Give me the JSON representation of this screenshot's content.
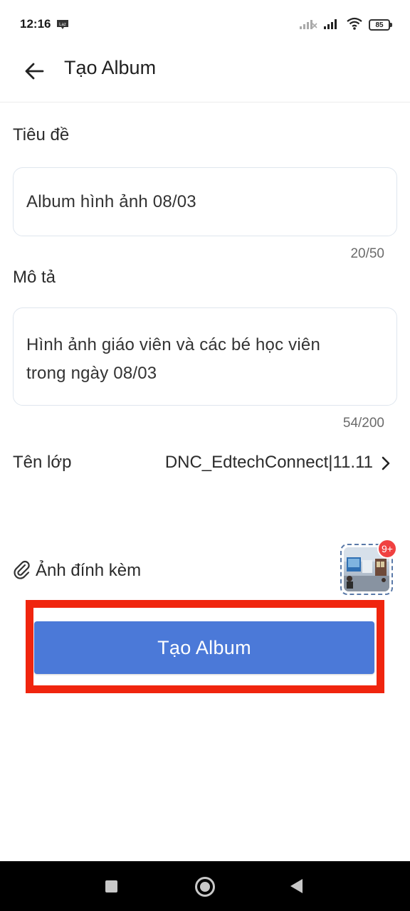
{
  "status_bar": {
    "time": "12:16",
    "laz_icon": "laz-icon",
    "battery": "85",
    "icons": [
      "no-signal-icon",
      "signal-icon",
      "wifi-icon",
      "battery-icon"
    ]
  },
  "header": {
    "back_icon": "arrow-left-icon",
    "title": "Tạo Album"
  },
  "form": {
    "title_label": "Tiêu đề",
    "title_value": "Album hình ảnh 08/03",
    "title_counter": "20/50",
    "description_label": "Mô tả",
    "description_value": "Hình ảnh giáo viên và các bé học viên trong ngày 08/03",
    "description_line1": "Hình ảnh giáo viên và các bé học viên",
    "description_line2": "trong ngày 08/03",
    "description_counter": "54/200",
    "class_label": "Tên lớp",
    "class_value": "DNC_EdtechConnect|11.11",
    "attachment_label": "Ảnh đính kèm",
    "attachment_icon": "paperclip-icon",
    "attachment_badge": "9+"
  },
  "actions": {
    "create_label": "Tạo Album"
  },
  "nav_bar": {
    "icons": [
      "recents-square-icon",
      "home-circle-icon",
      "back-triangle-icon"
    ]
  },
  "colors": {
    "primary": "#4b79d8",
    "highlight": "#f0250e",
    "badge": "#f04141",
    "input_border": "#dfe6ee"
  }
}
